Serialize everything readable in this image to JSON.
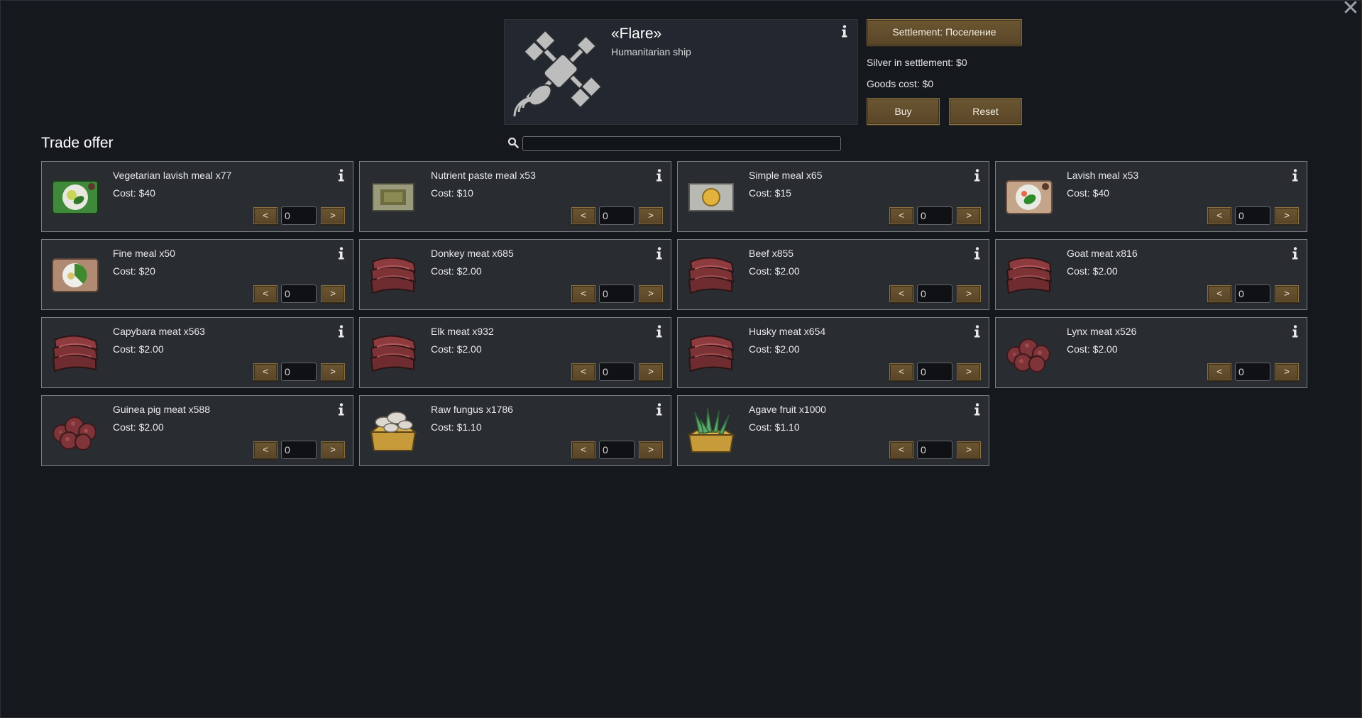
{
  "window": {
    "close_label": "✕"
  },
  "trader": {
    "name": "«Flare»",
    "kind": "Humanitarian ship",
    "icon": "satellite-icon"
  },
  "controls": {
    "settlement_label": "Settlement: Поселение",
    "silver_text": "Silver in settlement: $0",
    "goods_text": "Goods cost: $0",
    "buy_label": "Buy",
    "reset_label": "Reset"
  },
  "trade": {
    "title": "Trade offer",
    "search_value": "",
    "dec_label": "<",
    "inc_label": ">",
    "items": [
      {
        "name": "Vegetarian lavish meal x77",
        "cost": "Cost: $40",
        "qty": "0",
        "icon": "vegetarian-lavish-meal-icon"
      },
      {
        "name": "Nutrient paste meal x53",
        "cost": "Cost: $10",
        "qty": "0",
        "icon": "nutrient-paste-meal-icon"
      },
      {
        "name": "Simple meal x65",
        "cost": "Cost: $15",
        "qty": "0",
        "icon": "simple-meal-icon"
      },
      {
        "name": "Lavish meal x53",
        "cost": "Cost: $40",
        "qty": "0",
        "icon": "lavish-meal-icon"
      },
      {
        "name": "Fine meal x50",
        "cost": "Cost: $20",
        "qty": "0",
        "icon": "fine-meal-icon"
      },
      {
        "name": "Donkey meat x685",
        "cost": "Cost: $2.00",
        "qty": "0",
        "icon": "meat-icon"
      },
      {
        "name": "Beef x855",
        "cost": "Cost: $2.00",
        "qty": "0",
        "icon": "meat-icon"
      },
      {
        "name": "Goat meat x816",
        "cost": "Cost: $2.00",
        "qty": "0",
        "icon": "meat-icon"
      },
      {
        "name": "Capybara meat x563",
        "cost": "Cost: $2.00",
        "qty": "0",
        "icon": "meat-icon"
      },
      {
        "name": "Elk meat x932",
        "cost": "Cost: $2.00",
        "qty": "0",
        "icon": "meat-icon"
      },
      {
        "name": "Husky meat x654",
        "cost": "Cost: $2.00",
        "qty": "0",
        "icon": "meat-icon"
      },
      {
        "name": "Lynx meat x526",
        "cost": "Cost: $2.00",
        "qty": "0",
        "icon": "ground-meat-icon"
      },
      {
        "name": "Guinea pig meat x588",
        "cost": "Cost: $2.00",
        "qty": "0",
        "icon": "ground-meat-icon"
      },
      {
        "name": "Raw fungus x1786",
        "cost": "Cost: $1.10",
        "qty": "0",
        "icon": "raw-fungus-icon"
      },
      {
        "name": "Agave fruit x1000",
        "cost": "Cost: $1.10",
        "qty": "0",
        "icon": "agave-fruit-icon"
      }
    ]
  }
}
